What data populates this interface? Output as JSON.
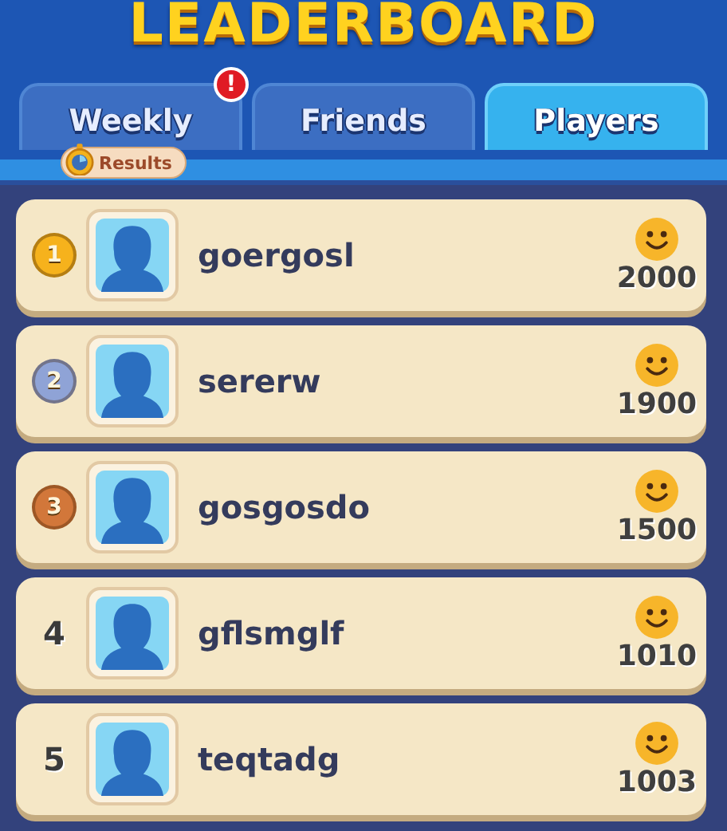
{
  "title": "LEADERBOARD",
  "tabs": [
    {
      "label": "Weekly",
      "selected": false,
      "alert": "!"
    },
    {
      "label": "Friends",
      "selected": false
    },
    {
      "label": "Players",
      "selected": true
    }
  ],
  "results_badge": "Results",
  "players": [
    {
      "kind": "medal",
      "color": "#f6b21c",
      "rank": "1",
      "name": "goergosl",
      "score": "2000"
    },
    {
      "kind": "medal",
      "color": "#8fa3d6",
      "rank": "2",
      "name": "sererw",
      "score": "1900"
    },
    {
      "kind": "medal",
      "color": "#d2773a",
      "rank": "3",
      "name": "gosgosdo",
      "score": "1500"
    },
    {
      "kind": "number",
      "rank": "4",
      "name": "gflsmglf",
      "score": "1010"
    },
    {
      "kind": "number",
      "rank": "5",
      "name": "teqtadg",
      "score": "1003"
    }
  ]
}
